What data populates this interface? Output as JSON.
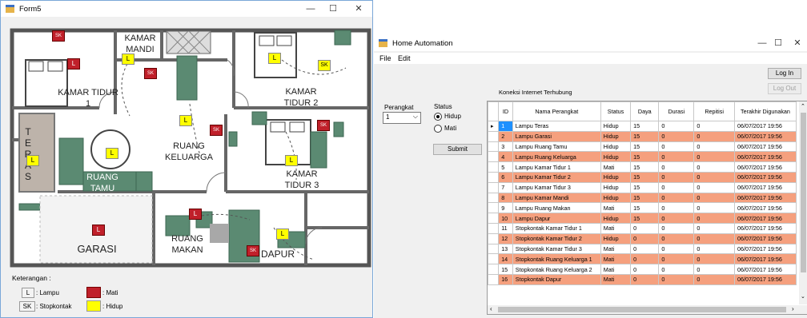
{
  "form5": {
    "title": "Form5",
    "controls": {
      "minimize": "—",
      "maximize": "☐",
      "close": "✕"
    },
    "rooms": {
      "kamar_mandi": "KAMAR MANDI",
      "kamar_tidur_1": "KAMAR TIDUR 1",
      "kamar_tidur_2": "KAMAR TIDUR 2",
      "kamar_tidur_3": "KAMAR TIDUR 3",
      "teras": "TERAS",
      "ruang_keluarga": "RUANG KELUARGA",
      "ruang_tamu": "RUANG TAMU",
      "garasi": "GARASI",
      "ruang_makan": "RUANG MAKAN",
      "dapur": "DAPUR"
    },
    "lamp_letter": "L",
    "socket_letters": "SK",
    "legend": {
      "title": "Keterangan :",
      "lampu_key": "L",
      "lampu_label": ": Lampu",
      "sk_key": "SK",
      "sk_label": ": Stopkontak",
      "mati_label": ": Mati",
      "hidup_label": ": Hidup"
    },
    "colors": {
      "on": "#ffff00",
      "off": "#c0202a",
      "furniture": "#5b8a72"
    }
  },
  "home_automation": {
    "title": "Home Automation",
    "controls": {
      "minimize": "—",
      "maximize": "☐",
      "close": "✕"
    },
    "menu": {
      "file": "File",
      "edit": "Edit"
    },
    "login": "Log In",
    "logout": "Log Out",
    "connection": "Koneksi Internet Terhubung",
    "perangkat_label": "Perangkat",
    "perangkat_value": "1",
    "status_label": "Status",
    "hidup": "Hidup",
    "mati": "Mati",
    "submit": "Submit",
    "columns": [
      "ID",
      "Nama Perangkat",
      "Status",
      "Daya",
      "Durasi",
      "Repitisi",
      "Terakhir Digunakan"
    ],
    "rows": [
      [
        "1",
        "Lampu Teras",
        "Hidup",
        "15",
        "0",
        "0",
        "06/07/2017 19:56"
      ],
      [
        "2",
        "Lampu Garasi",
        "Hidup",
        "15",
        "0",
        "0",
        "06/07/2017 19:56"
      ],
      [
        "3",
        "Lampu Ruang Tamu",
        "Hidup",
        "15",
        "0",
        "0",
        "06/07/2017 19:56"
      ],
      [
        "4",
        "Lampu Ruang Keluarga",
        "Hidup",
        "15",
        "0",
        "0",
        "06/07/2017 19:56"
      ],
      [
        "5",
        "Lampu Kamar Tidur 1",
        "Mati",
        "15",
        "0",
        "0",
        "06/07/2017 19:56"
      ],
      [
        "6",
        "Lampu Kamar Tidur 2",
        "Hidup",
        "15",
        "0",
        "0",
        "06/07/2017 19:56"
      ],
      [
        "7",
        "Lampu Kamar Tidur 3",
        "Hidup",
        "15",
        "0",
        "0",
        "06/07/2017 19:56"
      ],
      [
        "8",
        "Lampu Kamar Mandi",
        "Hidup",
        "15",
        "0",
        "0",
        "06/07/2017 19:56"
      ],
      [
        "9",
        "Lampu Ruang Makan",
        "Mati",
        "15",
        "0",
        "0",
        "06/07/2017 19:56"
      ],
      [
        "10",
        "Lampu Dapur",
        "Hidup",
        "15",
        "0",
        "0",
        "06/07/2017 19:56"
      ],
      [
        "11",
        "Stopkontak Kamar Tidur 1",
        "Mati",
        "0",
        "0",
        "0",
        "06/07/2017 19:56"
      ],
      [
        "12",
        "Stopkontak Kamar Tidur 2",
        "Hidup",
        "0",
        "0",
        "0",
        "06/07/2017 19:56"
      ],
      [
        "13",
        "Stopkontak Kamar Tidur 3",
        "Mati",
        "0",
        "0",
        "0",
        "06/07/2017 19:56"
      ],
      [
        "14",
        "Stopkontak Ruang Keluarga 1",
        "Mati",
        "0",
        "0",
        "0",
        "06/07/2017 19:56"
      ],
      [
        "15",
        "Stopkontak Ruang Keluarga 2",
        "Mati",
        "0",
        "0",
        "0",
        "06/07/2017 19:56"
      ],
      [
        "16",
        "Stopkontak Dapur",
        "Mati",
        "0",
        "0",
        "0",
        "06/07/2017 19:56"
      ]
    ],
    "colors": {
      "alt_row": "#f5a07e",
      "selected": "#1e90ff"
    }
  }
}
